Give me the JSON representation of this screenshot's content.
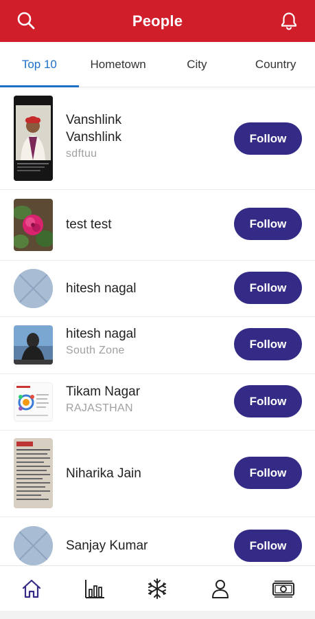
{
  "header": {
    "title": "People",
    "background_color": "#d01f2a",
    "left_icon": "search-icon",
    "right_icon": "bell-icon"
  },
  "tabs": [
    {
      "label": "Top 10",
      "active": true
    },
    {
      "label": "Hometown",
      "active": false
    },
    {
      "label": "City",
      "active": false
    },
    {
      "label": "Country",
      "active": false
    }
  ],
  "accent_color": "#1d6fc7",
  "button_color": "#332b85",
  "people": [
    {
      "name": "Vanshlink Vanshlink",
      "subtitle": "sdftuu",
      "avatar": "photo-man-turban",
      "follow_label": "Follow"
    },
    {
      "name": "test test",
      "subtitle": "",
      "avatar": "photo-pink-flower",
      "follow_label": "Follow"
    },
    {
      "name": "hitesh nagal",
      "subtitle": "",
      "avatar": "placeholder-circle",
      "follow_label": "Follow"
    },
    {
      "name": "hitesh nagal",
      "subtitle": "South Zone",
      "avatar": "photo-statue",
      "follow_label": "Follow"
    },
    {
      "name": "Tikam Nagar",
      "subtitle": "RAJASTHAN",
      "avatar": "photo-document",
      "follow_label": "Follow"
    },
    {
      "name": "Niharika Jain",
      "subtitle": "",
      "avatar": "photo-newspaper",
      "follow_label": "Follow"
    },
    {
      "name": "Sanjay Kumar",
      "subtitle": "",
      "avatar": "placeholder-circle",
      "follow_label": "Follow"
    }
  ],
  "bottom_nav": [
    {
      "icon": "home-icon",
      "active": true
    },
    {
      "icon": "bar-chart-icon",
      "active": false
    },
    {
      "icon": "snowflake-icon",
      "active": false
    },
    {
      "icon": "user-icon",
      "active": false
    },
    {
      "icon": "money-icon",
      "active": false
    }
  ]
}
